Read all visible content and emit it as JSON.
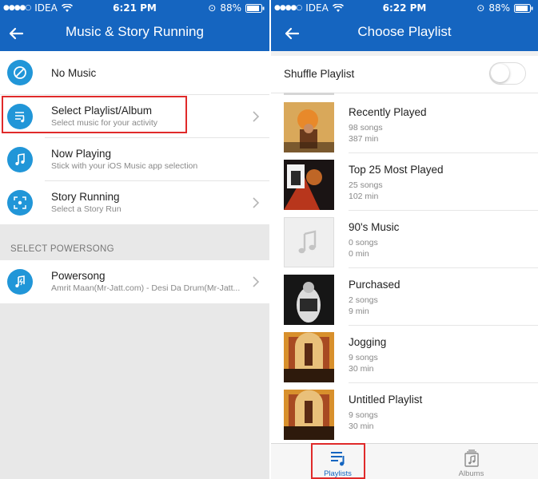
{
  "left": {
    "status": {
      "carrier": "IDEA",
      "time": "6:21 PM",
      "battery": "88%"
    },
    "nav": {
      "title": "Music & Story Running"
    },
    "options": [
      {
        "label": "No Music",
        "icon": "no-music-icon"
      },
      {
        "label": "Select Playlist/Album",
        "sub": "Select music for your activity",
        "icon": "playlist-icon"
      },
      {
        "label": "Now Playing",
        "sub": "Stick with your iOS Music app selection",
        "icon": "music-note-icon"
      },
      {
        "label": "Story Running",
        "sub": "Select a Story Run",
        "icon": "story-run-icon"
      }
    ],
    "section_header": "SELECT POWERSONG",
    "powersong": {
      "label": "Powersong",
      "sub": "Amrit Maan(Mr-Jatt.com) - Desi Da Drum(Mr-Jatt...",
      "icon": "powersong-icon"
    }
  },
  "right": {
    "status": {
      "carrier": "IDEA",
      "time": "6:22 PM",
      "battery": "88%"
    },
    "nav": {
      "title": "Choose Playlist"
    },
    "shuffle": {
      "label": "Shuffle Playlist",
      "on": false
    },
    "playlists": [
      {
        "name": "Recently Played",
        "songs": "98 songs",
        "mins": "387 min"
      },
      {
        "name": "Top 25 Most Played",
        "songs": "25 songs",
        "mins": "102 min"
      },
      {
        "name": "90's Music",
        "songs": "0 songs",
        "mins": "0 min"
      },
      {
        "name": "Purchased",
        "songs": "2 songs",
        "mins": "9 min"
      },
      {
        "name": "Jogging",
        "songs": "9 songs",
        "mins": "30 min"
      },
      {
        "name": "Untitled Playlist",
        "songs": "9 songs",
        "mins": "30 min"
      }
    ],
    "tabs": [
      {
        "label": "Playlists",
        "active": true
      },
      {
        "label": "Albums",
        "active": false
      }
    ]
  },
  "colors": {
    "brand": "#1565c0",
    "icon_circle": "#2196d8",
    "highlight": "#e02a2a"
  }
}
